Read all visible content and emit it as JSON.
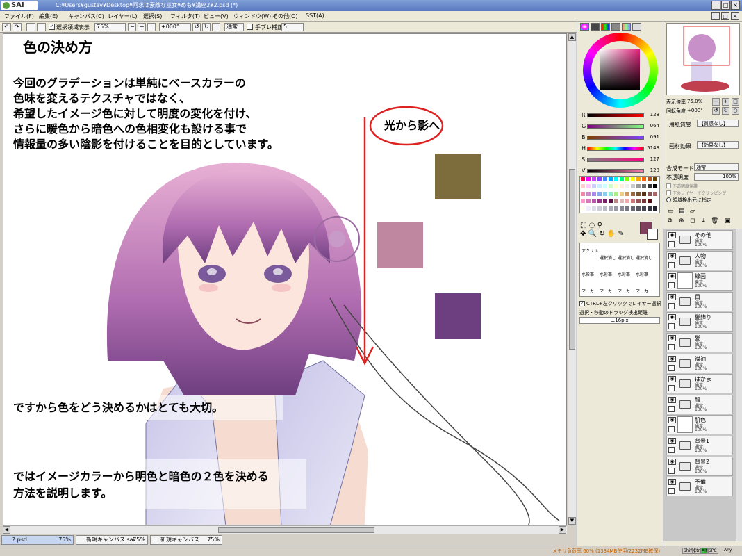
{
  "app": {
    "logo": "SAI",
    "title": "C:¥Users¥gustav¥Desktop¥阿求は素敵な巫女¥めも¥講座2¥2.psd (*)"
  },
  "menu": [
    "ファイル(F)",
    "編集(E)",
    "キャンバス(C)",
    "レイヤー(L)",
    "選択(S)",
    "フィルタ(T)",
    "ビュー(V)",
    "ウィンドウ(W)",
    "その他(O)",
    "SST(A)"
  ],
  "toolbar": {
    "show_selection": "選択領域表示",
    "zoom": "75%",
    "angle": "+000°",
    "mode": "通常",
    "stabilizer_label": "手ブレ補正",
    "stabilizer_value": "5"
  },
  "canvas": {
    "heading": "色の決め方",
    "para1": [
      "今回のグラデーションは単純にベースカラーの",
      "色味を変えるテクスチャではなく、",
      "希望したイメージ色に対して明度の変化を付け、",
      "さらに暖色から暗色への色相変化も設ける事で",
      "情報量の多い陰影を付けることを目的としています。"
    ],
    "para2": "ですから色をどう決めるかはとても大切。",
    "para3": [
      "ではイメージカラーから明色と暗色の２色を決める",
      "方法を説明します。"
    ],
    "arrow_label": "光から影へ",
    "swatches": {
      "olive": "#7d6c3c",
      "pink": "#bf88a0",
      "purple": "#6e3f80"
    }
  },
  "color_panel": {
    "sliders": [
      {
        "label": "R",
        "value": "128",
        "color": "#e03030"
      },
      {
        "label": "G",
        "value": "064",
        "color": "#30c030"
      },
      {
        "label": "B",
        "value": "091",
        "color": "#3030e0"
      },
      {
        "label": "H",
        "value": "5148",
        "color": "#ff00ff"
      },
      {
        "label": "S",
        "value": "127",
        "color": "#a04060"
      },
      {
        "label": "V",
        "value": "128",
        "color": "#804050"
      }
    ],
    "current_color": "#80405b"
  },
  "tools": {
    "row1": [
      "アクリル",
      "選択消し",
      "選択消し",
      "選択消し"
    ],
    "row2": [
      "水彩筆",
      "水彩筆",
      "水彩筆",
      "水彩筆"
    ],
    "row3": [
      "マーカー",
      "マーカー",
      "マーカー",
      "マーカー"
    ],
    "ctrl_left_click": "CTRL+左クリックでレイヤー選択",
    "drag_label": "選択・移動のドラッグ検出距離",
    "drag_value": "±16pix"
  },
  "navigator": {
    "zoom_label": "表示倍率",
    "zoom_value": "75.0%",
    "angle_label": "回転角度",
    "angle_value": "+000°"
  },
  "layer_panel": {
    "paper_label": "用紙質感",
    "paper_value": "【質感なし】",
    "effect_label": "画材効果",
    "effect_value": "【効果なし】",
    "blend_label": "合成モード",
    "blend_value": "通常",
    "opacity_label": "不透明度",
    "opacity_value": "100%",
    "cb1": "不透明度保護",
    "cb2": "下のレイヤーでクリッピング",
    "cb3": "領域検出元に指定",
    "layers": [
      {
        "name": "その他",
        "mode": "通常",
        "opacity": "100%",
        "type": "folder"
      },
      {
        "name": "人物",
        "mode": "通常",
        "opacity": "100%",
        "type": "folder"
      },
      {
        "name": "線画",
        "mode": "乗算",
        "opacity": "100%",
        "type": "layer"
      },
      {
        "name": "目",
        "mode": "通常",
        "opacity": "100%",
        "type": "folder"
      },
      {
        "name": "髪飾り",
        "mode": "通常",
        "opacity": "100%",
        "type": "folder"
      },
      {
        "name": "髪",
        "mode": "通常",
        "opacity": "100%",
        "type": "folder"
      },
      {
        "name": "襟袖",
        "mode": "通常",
        "opacity": "100%",
        "type": "folder"
      },
      {
        "name": "はかま",
        "mode": "通常",
        "opacity": "100%",
        "type": "folder"
      },
      {
        "name": "服",
        "mode": "通常",
        "opacity": "100%",
        "type": "folder"
      },
      {
        "name": "肌色",
        "mode": "通常",
        "opacity": "100%",
        "type": "layer"
      },
      {
        "name": "背景1",
        "mode": "通常",
        "opacity": "100%",
        "type": "folder"
      },
      {
        "name": "背景2",
        "mode": "通常",
        "opacity": "100%",
        "type": "folder"
      },
      {
        "name": "予備",
        "mode": "通常",
        "opacity": "100%",
        "type": "folder"
      }
    ]
  },
  "tabs": [
    {
      "name": "2.psd",
      "zoom": "75%"
    },
    {
      "name": "新規キャンバス.sai",
      "zoom": "75%"
    },
    {
      "name": "新規キャンバス",
      "zoom": "75%"
    }
  ],
  "status": {
    "memory": "メモリ負荷率 60% (1334MB使用/2232MB確保)",
    "keys": [
      "Shift",
      "Ctrl",
      "Alt",
      "SPC"
    ],
    "any": "Any"
  }
}
